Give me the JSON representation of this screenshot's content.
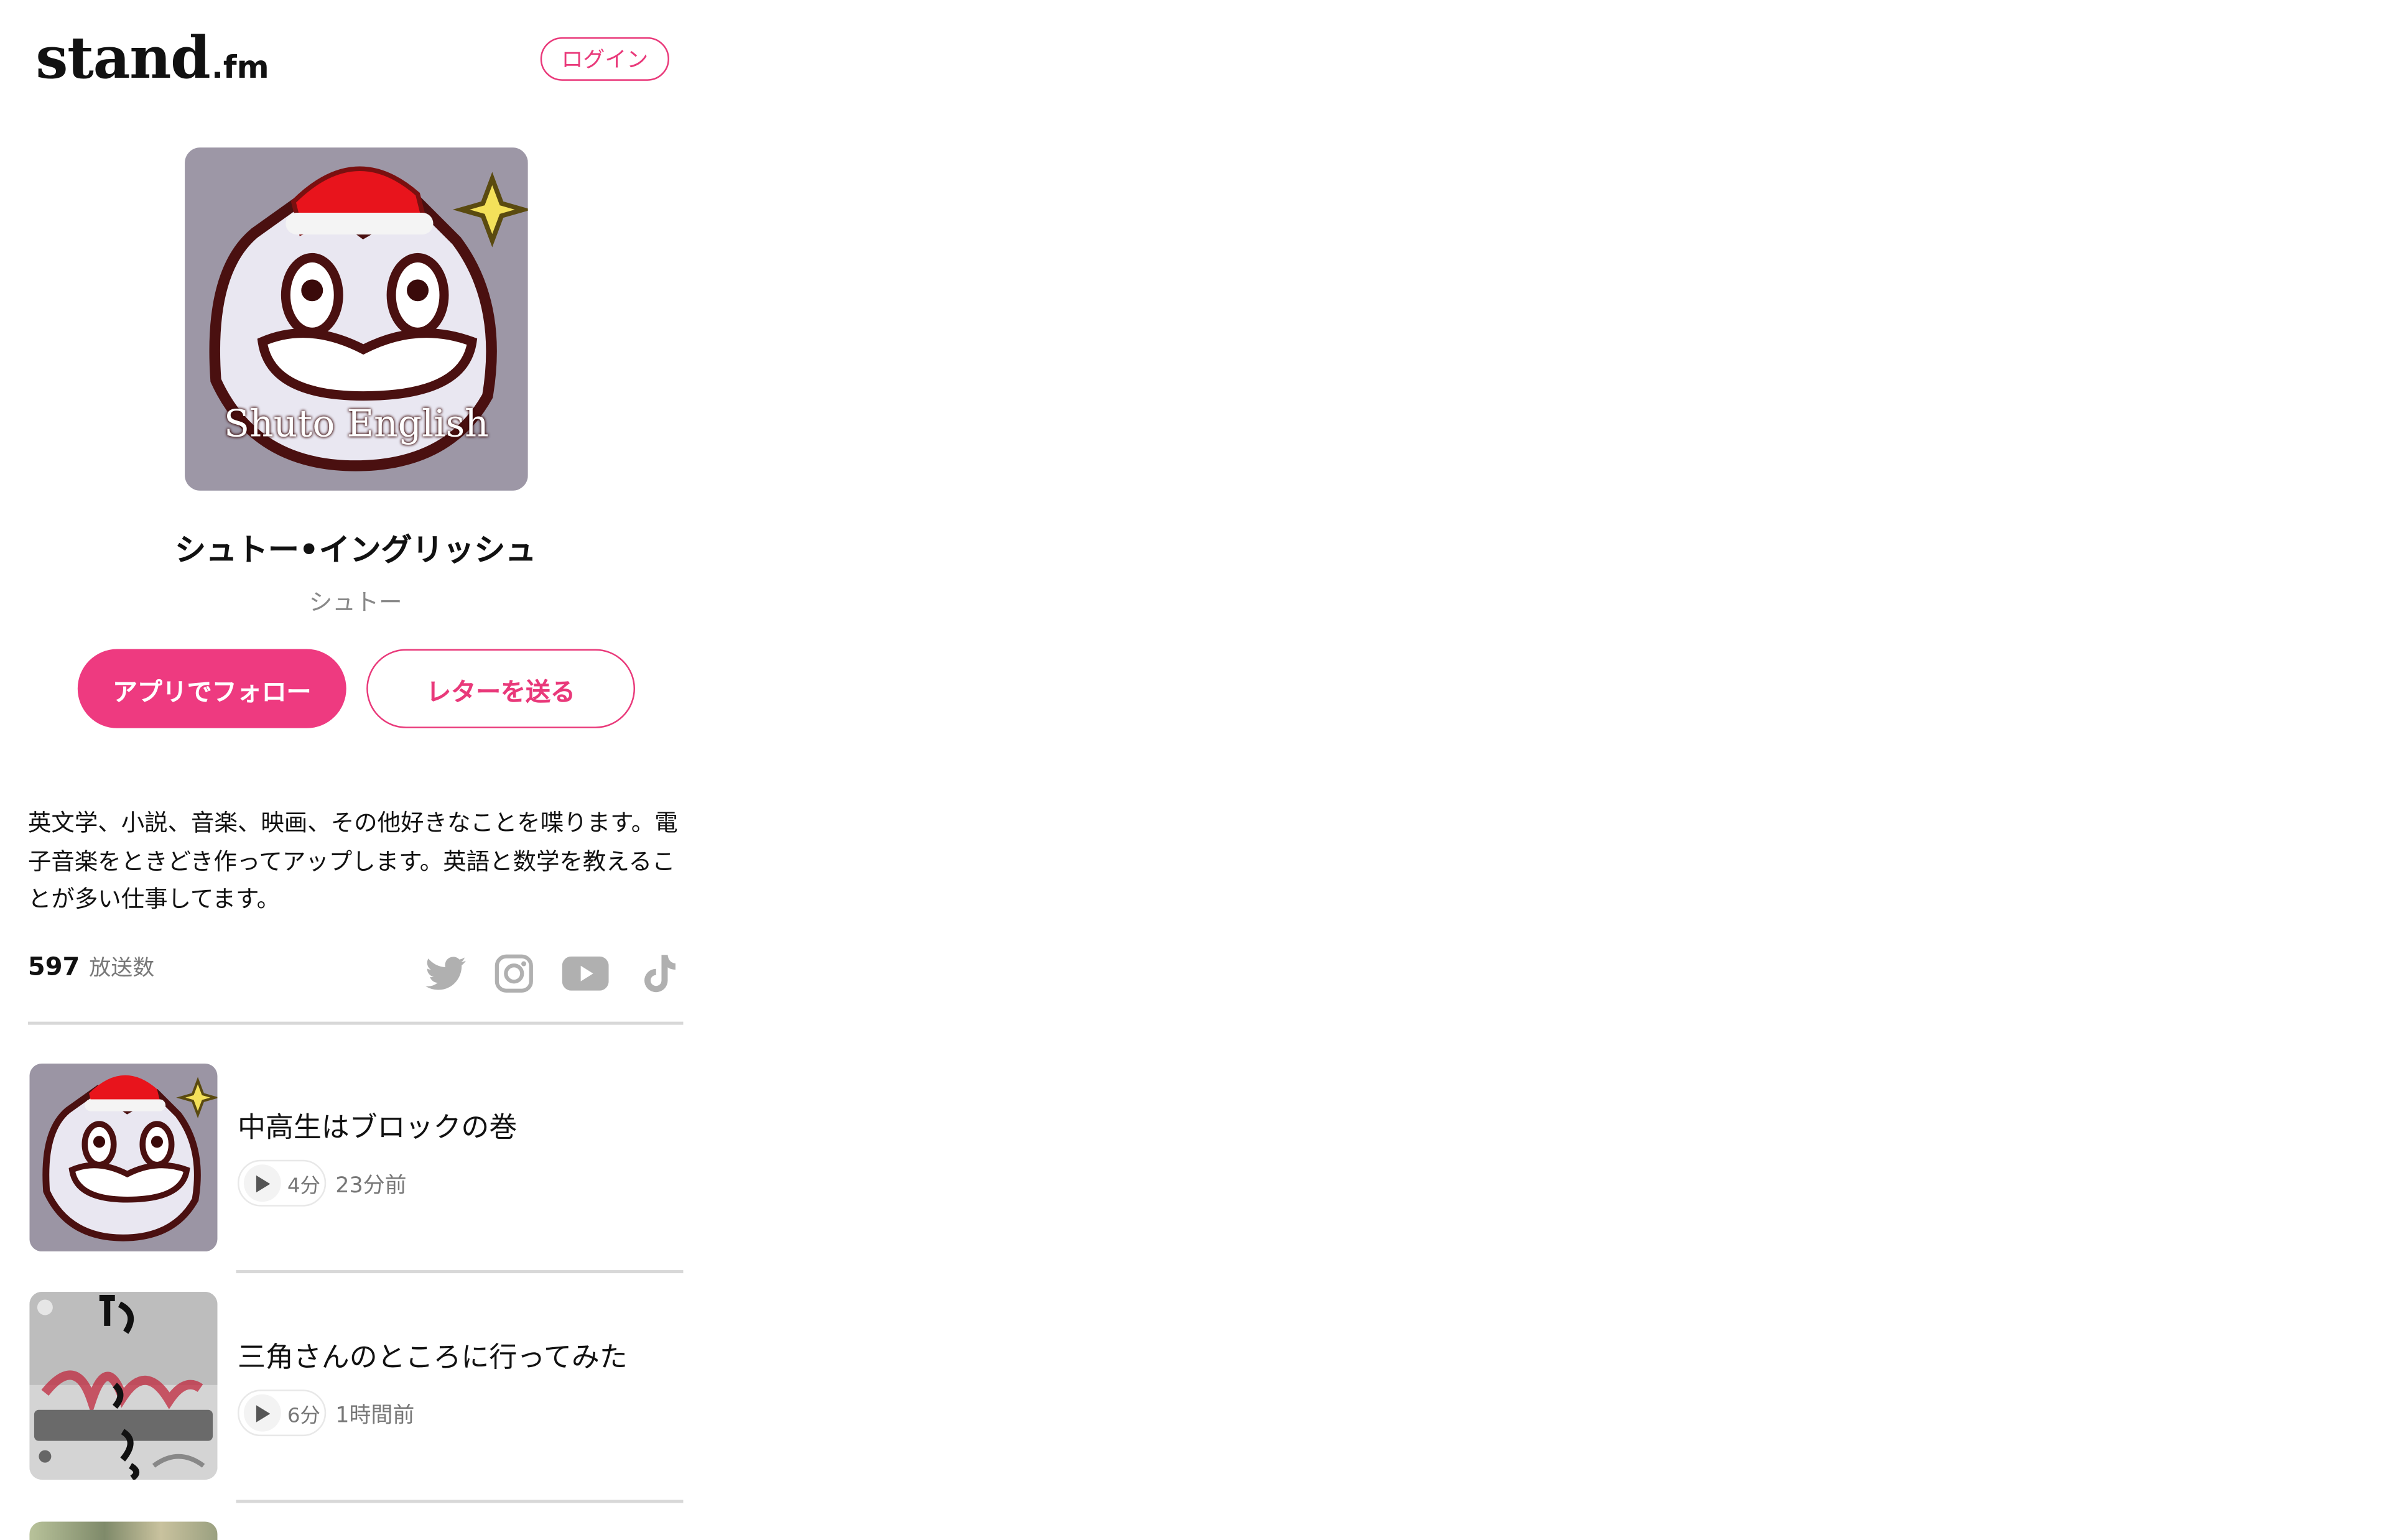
{
  "header": {
    "logo_main": "stand",
    "logo_sub": ".fm",
    "login_label": "ログイン"
  },
  "profile": {
    "avatar_text": "Shuto English",
    "name": "シュトー•イングリッシュ",
    "handle": "シュトー",
    "follow_label": "アプリでフォロー",
    "letter_label": "レターを送る",
    "bio": "英文学、小説、音楽、映画、その他好きなことを喋ります。電子音楽をときどき作ってアップします。英語と数学を教えることが多い仕事してます。",
    "broadcast_count": "597",
    "broadcast_label": "放送数"
  },
  "social": [
    "twitter-icon",
    "instagram-icon",
    "youtube-icon",
    "tiktok-icon"
  ],
  "episodes": [
    {
      "title": "中高生はブロックの巻",
      "duration": "4分",
      "time": "23分前"
    },
    {
      "title": "三角さんのところに行ってみた",
      "duration": "6分",
      "time": "1時間前"
    }
  ],
  "colors": {
    "accent": "#ee3a80",
    "muted_text": "#888888",
    "icon_gray": "#b0b0b0"
  }
}
